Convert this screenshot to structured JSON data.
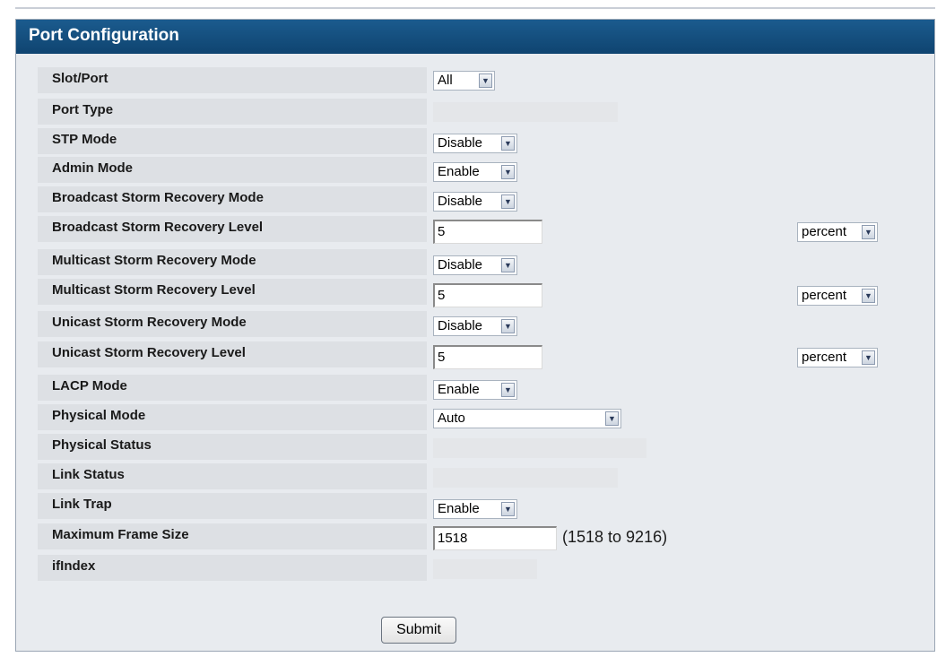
{
  "panel": {
    "title": "Port Configuration"
  },
  "fields": {
    "slot_port": {
      "label": "Slot/Port",
      "value": "All"
    },
    "port_type": {
      "label": "Port Type",
      "value": ""
    },
    "stp_mode": {
      "label": "STP Mode",
      "value": "Disable"
    },
    "admin_mode": {
      "label": "Admin Mode",
      "value": "Enable"
    },
    "bcast_mode": {
      "label": "Broadcast Storm Recovery Mode",
      "value": "Disable"
    },
    "bcast_level": {
      "label": "Broadcast Storm Recovery Level",
      "value": "5",
      "unit": "percent"
    },
    "mcast_mode": {
      "label": "Multicast Storm Recovery Mode",
      "value": "Disable"
    },
    "mcast_level": {
      "label": "Multicast Storm Recovery Level",
      "value": "5",
      "unit": "percent"
    },
    "ucast_mode": {
      "label": "Unicast Storm Recovery Mode",
      "value": "Disable"
    },
    "ucast_level": {
      "label": "Unicast Storm Recovery Level",
      "value": "5",
      "unit": "percent"
    },
    "lacp_mode": {
      "label": "LACP Mode",
      "value": "Enable"
    },
    "physical_mode": {
      "label": "Physical Mode",
      "value": "Auto"
    },
    "physical_status": {
      "label": "Physical Status",
      "value": ""
    },
    "link_status": {
      "label": "Link Status",
      "value": ""
    },
    "link_trap": {
      "label": "Link Trap",
      "value": "Enable"
    },
    "max_frame": {
      "label": "Maximum Frame Size",
      "value": "1518",
      "range": "(1518 to 9216)"
    },
    "ifindex": {
      "label": "ifIndex",
      "value": ""
    }
  },
  "submit_label": "Submit",
  "icons": {
    "dropdown": "chevron-down-icon"
  },
  "colors": {
    "header": "#1b5b8e",
    "panel": "#e8ebef",
    "label_bg": "#dde0e4"
  }
}
